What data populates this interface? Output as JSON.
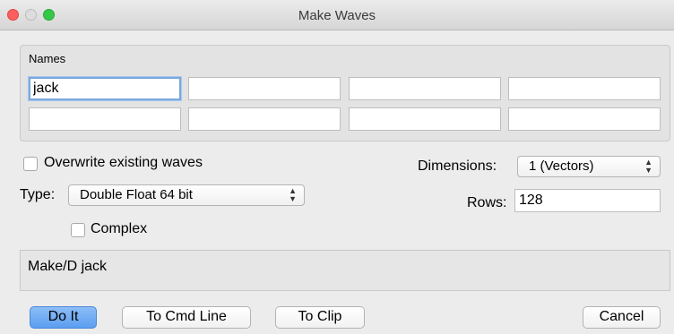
{
  "window": {
    "title": "Make Waves"
  },
  "names": {
    "label": "Names",
    "fields": [
      "jack",
      "",
      "",
      "",
      "",
      "",
      "",
      ""
    ]
  },
  "overwrite": {
    "label": "Overwrite existing waves",
    "checked": false
  },
  "dimensions": {
    "label": "Dimensions:",
    "value": "1 (Vectors)"
  },
  "type": {
    "label": "Type:",
    "value": "Double Float 64 bit"
  },
  "rows": {
    "label": "Rows:",
    "value": "128"
  },
  "complex": {
    "label": "Complex",
    "checked": false
  },
  "command": {
    "text": "Make/D jack"
  },
  "buttons": {
    "do_it": "Do It",
    "to_cmd_line": "To Cmd Line",
    "to_clip": "To Clip",
    "cancel": "Cancel"
  },
  "popup_arrows": "▲▼",
  "colors": {
    "default_button": "#5b9ef0",
    "close": "#fc605c",
    "zoom": "#34c748"
  }
}
